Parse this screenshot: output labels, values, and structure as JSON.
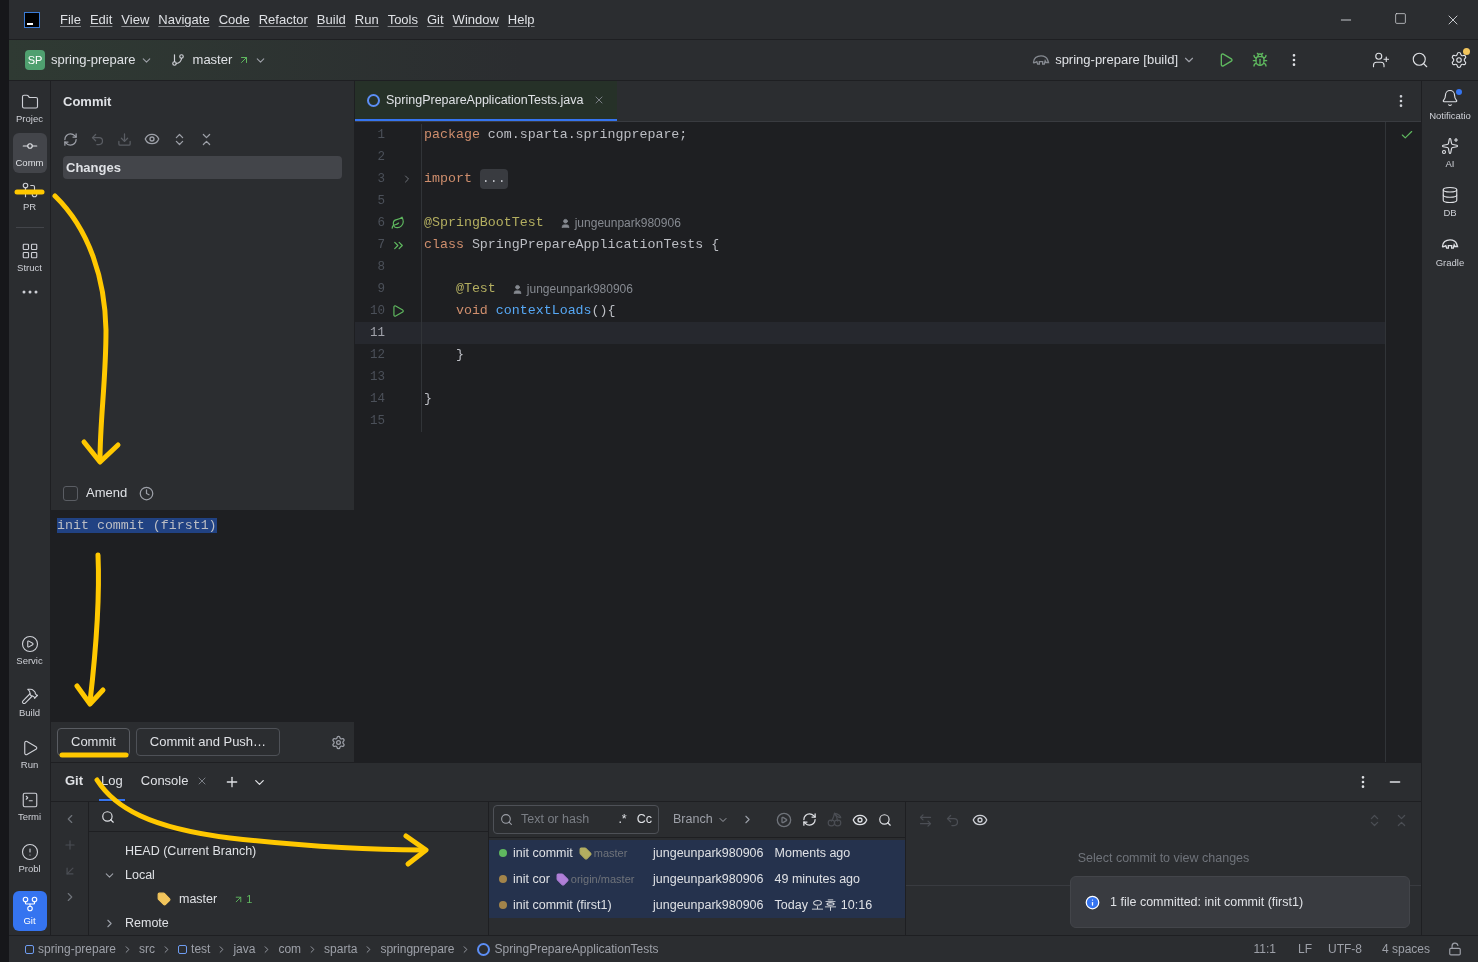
{
  "menu": [
    "File",
    "Edit",
    "View",
    "Navigate",
    "Code",
    "Refactor",
    "Build",
    "Run",
    "Tools",
    "Git",
    "Window",
    "Help"
  ],
  "toolbar": {
    "project_badge": "SP",
    "project": "spring-prepare",
    "branch": "master",
    "run_config": "spring-prepare [build]"
  },
  "left_tools_top": [
    {
      "kind": "folder",
      "label": "Projec",
      "selected": false
    },
    {
      "kind": "commit",
      "label": "Comm",
      "selected": true
    },
    {
      "kind": "pr",
      "label": "PR",
      "selected": false
    },
    {
      "kind": "structure",
      "label": "Struct",
      "selected": false
    },
    {
      "kind": "more",
      "selected": false
    }
  ],
  "left_tools_bottom": [
    {
      "kind": "services",
      "label": "Servic",
      "selected": false
    },
    {
      "kind": "build",
      "label": "Build",
      "selected": false
    },
    {
      "kind": "run",
      "label": "Run",
      "selected": false
    },
    {
      "kind": "terminal",
      "label": "Termi",
      "selected": false
    },
    {
      "kind": "problems",
      "label": "Probl",
      "selected": false
    },
    {
      "kind": "git",
      "label": "Git",
      "selected": true
    }
  ],
  "commit_panel": {
    "title": "Commit",
    "changes_label": "Changes",
    "amend": {
      "label": "Amend",
      "checked": false
    },
    "message": "init commit (first1)",
    "buttons": [
      "Commit",
      "Commit and Push…"
    ]
  },
  "editor": {
    "tab": "SpringPrepareApplicationTests.java",
    "lines": [
      {
        "number": "1",
        "current": false,
        "tokens": [
          {
            "kind": "keyword",
            "text": "package"
          },
          {
            "kind": "plain",
            "text": " com.sparta.springprepare;"
          }
        ]
      },
      {
        "number": "2",
        "current": false
      },
      {
        "number": "3",
        "current": false,
        "kind": "fold",
        "tokens": [
          {
            "kind": "keyword",
            "text": "import "
          },
          {
            "kind": "folded",
            "text": "..."
          }
        ]
      },
      {
        "number": "5",
        "current": false
      },
      {
        "number": "6",
        "current": false,
        "kind": "bean",
        "tokens": [
          {
            "kind": "annotation",
            "text": "@SpringBootTest"
          },
          {
            "kind": "author",
            "text": "jungeunpark980906"
          }
        ]
      },
      {
        "number": "7",
        "current": false,
        "kind": "run_all",
        "tokens": [
          {
            "kind": "keyword",
            "text": "class"
          },
          {
            "kind": "plain",
            "text": " SpringPrepareApplicationTests {"
          }
        ]
      },
      {
        "number": "8",
        "current": false
      },
      {
        "number": "9",
        "current": false,
        "tokens": [
          {
            "kind": "annotation",
            "text": "    @Test"
          },
          {
            "kind": "author",
            "text": "jungeunpark980906"
          }
        ]
      },
      {
        "number": "10",
        "current": false,
        "kind": "run",
        "tokens": [
          {
            "kind": "keyword",
            "text": "    void "
          },
          {
            "kind": "function",
            "text": "contextLoads"
          },
          {
            "kind": "plain",
            "text": "(){"
          }
        ]
      },
      {
        "number": "11",
        "current": true
      },
      {
        "number": "12",
        "current": false,
        "tokens": [
          {
            "kind": "plain",
            "text": "    }"
          }
        ]
      },
      {
        "number": "13",
        "current": false
      },
      {
        "number": "14",
        "current": false,
        "tokens": [
          {
            "kind": "plain",
            "text": "}"
          }
        ]
      },
      {
        "number": "15",
        "current": false
      }
    ]
  },
  "right_tools": [
    {
      "kind": "bell",
      "label": "Notificatio"
    },
    {
      "kind": "ai",
      "label": "AI"
    },
    {
      "kind": "db",
      "label": "DB"
    },
    {
      "kind": "gradle",
      "label": "Gradle"
    }
  ],
  "git_panel": {
    "tabs": [
      {
        "label": "Git",
        "selected": false,
        "closable": false
      },
      {
        "label": "Log",
        "selected": true,
        "closable": false
      },
      {
        "label": "Console",
        "selected": false,
        "closable": true
      }
    ],
    "branches": [
      {
        "kind": "leaf",
        "label": "HEAD (Current Branch)"
      },
      {
        "kind": "group",
        "label": "Local",
        "expanded": true,
        "children": [
          {
            "kind": "branch",
            "label": "master",
            "ahead": "1"
          }
        ]
      },
      {
        "kind": "group",
        "label": "Remote",
        "expanded": false
      }
    ],
    "filter": {
      "placeholder": "Text or hash",
      "regex": ".*",
      "case": "Cc",
      "branch": "Branch"
    },
    "commits": [
      {
        "message": "init commit",
        "color": "#5fb85f",
        "ref": {
          "label": "master",
          "color": "#b3ae60"
        },
        "author": "jungeunpark980906",
        "date": "Moments ago",
        "selected": true
      },
      {
        "message": "init cor",
        "color": "#a3844a",
        "ref": {
          "label": "origin/master",
          "color": "#b07fd8"
        },
        "author": "jungeunpark980906",
        "date": "49 minutes ago",
        "selected": true
      },
      {
        "message": "init commit (first1)",
        "color": "#a3844a",
        "author": "jungeunpark980906",
        "date": "Today 오후 10:16",
        "selected": true
      }
    ],
    "details_hint": "Select commit to view changes",
    "notification": "1 file committed: init commit (first1)"
  },
  "status_bar": {
    "breadcrumbs": [
      {
        "kind": "module",
        "label": "spring-prepare"
      },
      {
        "kind": "folder",
        "label": "src"
      },
      {
        "kind": "module",
        "label": "test"
      },
      {
        "kind": "folder",
        "label": "java"
      },
      {
        "kind": "folder",
        "label": "com"
      },
      {
        "kind": "folder",
        "label": "sparta"
      },
      {
        "kind": "folder",
        "label": "springprepare"
      },
      {
        "kind": "class",
        "label": "SpringPrepareApplicationTests"
      }
    ],
    "position": "11:1",
    "line_separator": "LF",
    "encoding": "UTF-8",
    "indent": "4 spaces"
  }
}
